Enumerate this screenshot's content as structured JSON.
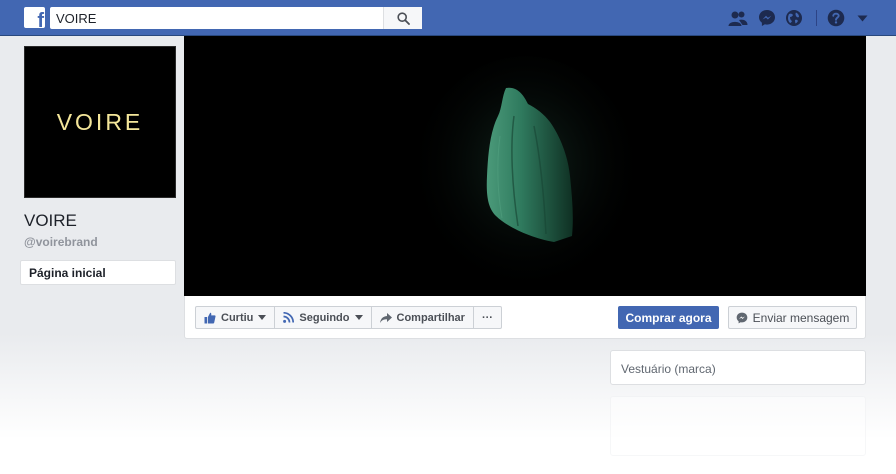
{
  "header": {
    "logo_letter": "f",
    "search_value": "VOIRE",
    "icons": [
      "search-icon",
      "friends-icon",
      "messenger-icon",
      "globe-icon",
      "help-icon",
      "caret-down-icon"
    ]
  },
  "sidebar": {
    "profile_text": "VOIRE",
    "page_name": "VOIRE",
    "handle": "@voirebrand",
    "nav_items": [
      {
        "label": "Página inicial"
      }
    ]
  },
  "actions": {
    "like_label": "Curtiu",
    "follow_label": "Seguindo",
    "share_label": "Compartilhar",
    "more_label": "···",
    "shop_label": "Comprar agora",
    "message_label": "Enviar mensagem"
  },
  "about": {
    "category": "Vestuário (marca)"
  },
  "colors": {
    "brand_blue": "#4267b2",
    "page_bg": "#e9ebee",
    "logo_text": "#f4e69a",
    "cover_bg": "#000000",
    "figure_green": "#2f7a5e"
  }
}
